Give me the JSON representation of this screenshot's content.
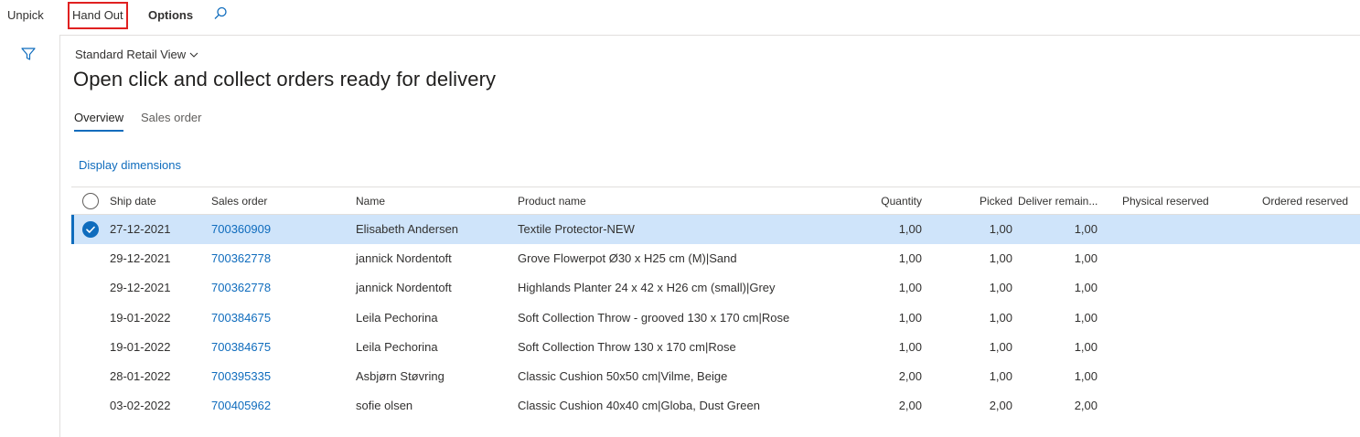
{
  "actionbar": {
    "unpick": "Unpick",
    "hand_out": "Hand Out",
    "options": "Options"
  },
  "header": {
    "view_name": "Standard Retail View",
    "title": "Open click and collect orders ready for delivery"
  },
  "tabs": [
    {
      "label": "Overview",
      "active": true
    },
    {
      "label": "Sales order",
      "active": false
    }
  ],
  "display_dimensions": "Display dimensions",
  "grid": {
    "columns": {
      "ship_date": "Ship date",
      "sales_order": "Sales order",
      "name": "Name",
      "product_name": "Product name",
      "quantity": "Quantity",
      "picked": "Picked",
      "deliver_remainder": "Deliver remain...",
      "physical_reserved": "Physical reserved",
      "ordered_reserved": "Ordered reserved"
    },
    "rows": [
      {
        "ship_date": "27-12-2021",
        "sales_order": "700360909",
        "name": "Elisabeth Andersen",
        "product_name": "Textile Protector-NEW",
        "quantity": "1,00",
        "picked": "1,00",
        "deliver_remainder": "1,00",
        "physical_reserved": "",
        "ordered_reserved": "",
        "selected": true
      },
      {
        "ship_date": "29-12-2021",
        "sales_order": "700362778",
        "name": "jannick Nordentoft",
        "product_name": "Grove Flowerpot Ø30 x H25 cm (M)|Sand",
        "quantity": "1,00",
        "picked": "1,00",
        "deliver_remainder": "1,00",
        "physical_reserved": "",
        "ordered_reserved": "",
        "selected": false
      },
      {
        "ship_date": "29-12-2021",
        "sales_order": "700362778",
        "name": "jannick Nordentoft",
        "product_name": "Highlands Planter 24 x 42 x H26 cm (small)|Grey",
        "quantity": "1,00",
        "picked": "1,00",
        "deliver_remainder": "1,00",
        "physical_reserved": "",
        "ordered_reserved": "",
        "selected": false
      },
      {
        "ship_date": "19-01-2022",
        "sales_order": "700384675",
        "name": "Leila Pechorina",
        "product_name": "Soft Collection Throw - grooved 130 x 170 cm|Rose",
        "quantity": "1,00",
        "picked": "1,00",
        "deliver_remainder": "1,00",
        "physical_reserved": "",
        "ordered_reserved": "",
        "selected": false
      },
      {
        "ship_date": "19-01-2022",
        "sales_order": "700384675",
        "name": "Leila Pechorina",
        "product_name": "Soft Collection Throw 130 x 170 cm|Rose",
        "quantity": "1,00",
        "picked": "1,00",
        "deliver_remainder": "1,00",
        "physical_reserved": "",
        "ordered_reserved": "",
        "selected": false
      },
      {
        "ship_date": "28-01-2022",
        "sales_order": "700395335",
        "name": "Asbjørn Støvring",
        "product_name": "Classic Cushion 50x50 cm|Vilme, Beige",
        "quantity": "2,00",
        "picked": "1,00",
        "deliver_remainder": "1,00",
        "physical_reserved": "",
        "ordered_reserved": "",
        "selected": false
      },
      {
        "ship_date": "03-02-2022",
        "sales_order": "700405962",
        "name": "sofie olsen",
        "product_name": "Classic Cushion 40x40 cm|Globa, Dust Green",
        "quantity": "2,00",
        "picked": "2,00",
        "deliver_remainder": "2,00",
        "physical_reserved": "",
        "ordered_reserved": "",
        "selected": false
      }
    ]
  },
  "colors": {
    "accent": "#0f6cbd",
    "selected_row": "#cfe4fa",
    "highlight_box": "#e02020"
  }
}
